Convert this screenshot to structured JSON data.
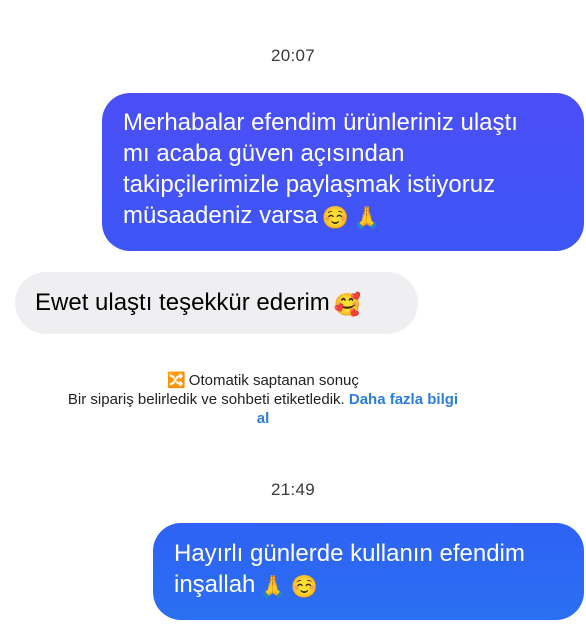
{
  "messages": {
    "timestamp_1": "20:07",
    "out_1": {
      "line1": "Merhabalar efendim ürünleriniz ulaştı",
      "line2": "mı acaba güven açısından",
      "line3": "takipçilerimizle paylaşmak istiyoruz",
      "line4": "müsaadeniz varsa",
      "emoji_a": "☺️",
      "emoji_b": "🙏"
    },
    "in_1": {
      "text": "Ewet ulaştı teşekkür ederim",
      "emoji": "🥰"
    },
    "system": {
      "icon": "🔀",
      "title": "Otomatik saptanan sonuç",
      "text": "Bir sipariş belirledik ve sohbeti etiketledik.",
      "link_part1": "Daha fazla bilgi",
      "link_part2": "al"
    },
    "timestamp_2": "21:49",
    "out_2": {
      "line1": "Hayırlı günlerde kullanın efendim",
      "line2": "inşallah",
      "emoji_a": "🙏",
      "emoji_b": "☺️"
    }
  },
  "colors": {
    "outgoing_bubble_1": "#4b4ef6",
    "outgoing_bubble_2": "#2f62f4",
    "incoming_bubble": "#efeff1",
    "link": "#2a7de1"
  },
  "icons": {
    "system_notice": "auto-detect-icon"
  }
}
